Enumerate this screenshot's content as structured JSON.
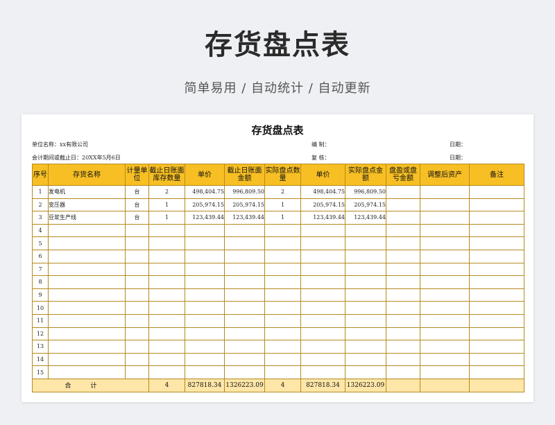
{
  "header": {
    "title": "存货盘点表",
    "subtitle": "简单易用 / 自动统计 / 自动更新"
  },
  "sheet": {
    "title": "存货盘点表",
    "unit_label": "单位名称：xx有限公司",
    "period_label": "会计期间或截止日：20XX年5月6日",
    "maker_label": "编 制：",
    "reviewer_label": "复 核：",
    "date_label_1": "日期：",
    "date_label_2": "日期："
  },
  "table": {
    "headers": [
      "序号",
      "存货名称",
      "计量单位",
      "截止日账面库存数量",
      "单价",
      "截止日账面金额",
      "实际盘点数量",
      "单价",
      "实际盘点金额",
      "盘盈或盘亏金额",
      "调整后资产",
      "备注"
    ],
    "rows": [
      {
        "no": "1",
        "name": "发电机",
        "unit": "台",
        "book_qty": "2",
        "book_price": "498,404.75",
        "book_amount": "996,809.50",
        "actual_qty": "2",
        "actual_price": "498,404.75",
        "actual_amount": "996,809.50",
        "diff": "",
        "adjusted": "",
        "remark": ""
      },
      {
        "no": "2",
        "name": "变压器",
        "unit": "台",
        "book_qty": "1",
        "book_price": "205,974.15",
        "book_amount": "205,974.15",
        "actual_qty": "1",
        "actual_price": "205,974.15",
        "actual_amount": "205,974.15",
        "diff": "",
        "adjusted": "",
        "remark": ""
      },
      {
        "no": "3",
        "name": "豆浆生产线",
        "unit": "台",
        "book_qty": "1",
        "book_price": "123,439.44",
        "book_amount": "123,439.44",
        "actual_qty": "1",
        "actual_price": "123,439.44",
        "actual_amount": "123,439.44",
        "diff": "",
        "adjusted": "",
        "remark": ""
      },
      {
        "no": "4",
        "name": "",
        "unit": "",
        "book_qty": "",
        "book_price": "",
        "book_amount": "",
        "actual_qty": "",
        "actual_price": "",
        "actual_amount": "",
        "diff": "",
        "adjusted": "",
        "remark": ""
      },
      {
        "no": "5",
        "name": "",
        "unit": "",
        "book_qty": "",
        "book_price": "",
        "book_amount": "",
        "actual_qty": "",
        "actual_price": "",
        "actual_amount": "",
        "diff": "",
        "adjusted": "",
        "remark": ""
      },
      {
        "no": "6",
        "name": "",
        "unit": "",
        "book_qty": "",
        "book_price": "",
        "book_amount": "",
        "actual_qty": "",
        "actual_price": "",
        "actual_amount": "",
        "diff": "",
        "adjusted": "",
        "remark": ""
      },
      {
        "no": "7",
        "name": "",
        "unit": "",
        "book_qty": "",
        "book_price": "",
        "book_amount": "",
        "actual_qty": "",
        "actual_price": "",
        "actual_amount": "",
        "diff": "",
        "adjusted": "",
        "remark": ""
      },
      {
        "no": "8",
        "name": "",
        "unit": "",
        "book_qty": "",
        "book_price": "",
        "book_amount": "",
        "actual_qty": "",
        "actual_price": "",
        "actual_amount": "",
        "diff": "",
        "adjusted": "",
        "remark": ""
      },
      {
        "no": "9",
        "name": "",
        "unit": "",
        "book_qty": "",
        "book_price": "",
        "book_amount": "",
        "actual_qty": "",
        "actual_price": "",
        "actual_amount": "",
        "diff": "",
        "adjusted": "",
        "remark": ""
      },
      {
        "no": "10",
        "name": "",
        "unit": "",
        "book_qty": "",
        "book_price": "",
        "book_amount": "",
        "actual_qty": "",
        "actual_price": "",
        "actual_amount": "",
        "diff": "",
        "adjusted": "",
        "remark": ""
      },
      {
        "no": "11",
        "name": "",
        "unit": "",
        "book_qty": "",
        "book_price": "",
        "book_amount": "",
        "actual_qty": "",
        "actual_price": "",
        "actual_amount": "",
        "diff": "",
        "adjusted": "",
        "remark": ""
      },
      {
        "no": "12",
        "name": "",
        "unit": "",
        "book_qty": "",
        "book_price": "",
        "book_amount": "",
        "actual_qty": "",
        "actual_price": "",
        "actual_amount": "",
        "diff": "",
        "adjusted": "",
        "remark": ""
      },
      {
        "no": "13",
        "name": "",
        "unit": "",
        "book_qty": "",
        "book_price": "",
        "book_amount": "",
        "actual_qty": "",
        "actual_price": "",
        "actual_amount": "",
        "diff": "",
        "adjusted": "",
        "remark": ""
      },
      {
        "no": "14",
        "name": "",
        "unit": "",
        "book_qty": "",
        "book_price": "",
        "book_amount": "",
        "actual_qty": "",
        "actual_price": "",
        "actual_amount": "",
        "diff": "",
        "adjusted": "",
        "remark": ""
      },
      {
        "no": "15",
        "name": "",
        "unit": "",
        "book_qty": "",
        "book_price": "",
        "book_amount": "",
        "actual_qty": "",
        "actual_price": "",
        "actual_amount": "",
        "diff": "",
        "adjusted": "",
        "remark": ""
      }
    ],
    "total": {
      "label": "合计",
      "book_qty": "4",
      "book_amount": "827818.34",
      "actual_amount_book": "1326223.09",
      "actual_qty": "4",
      "actual_amount": "827818.34",
      "actual_total": "1326223.09"
    }
  },
  "colors": {
    "header_bg": "#f7bf24",
    "total_bg": "#fde6a8",
    "border": "#b58a1e"
  }
}
